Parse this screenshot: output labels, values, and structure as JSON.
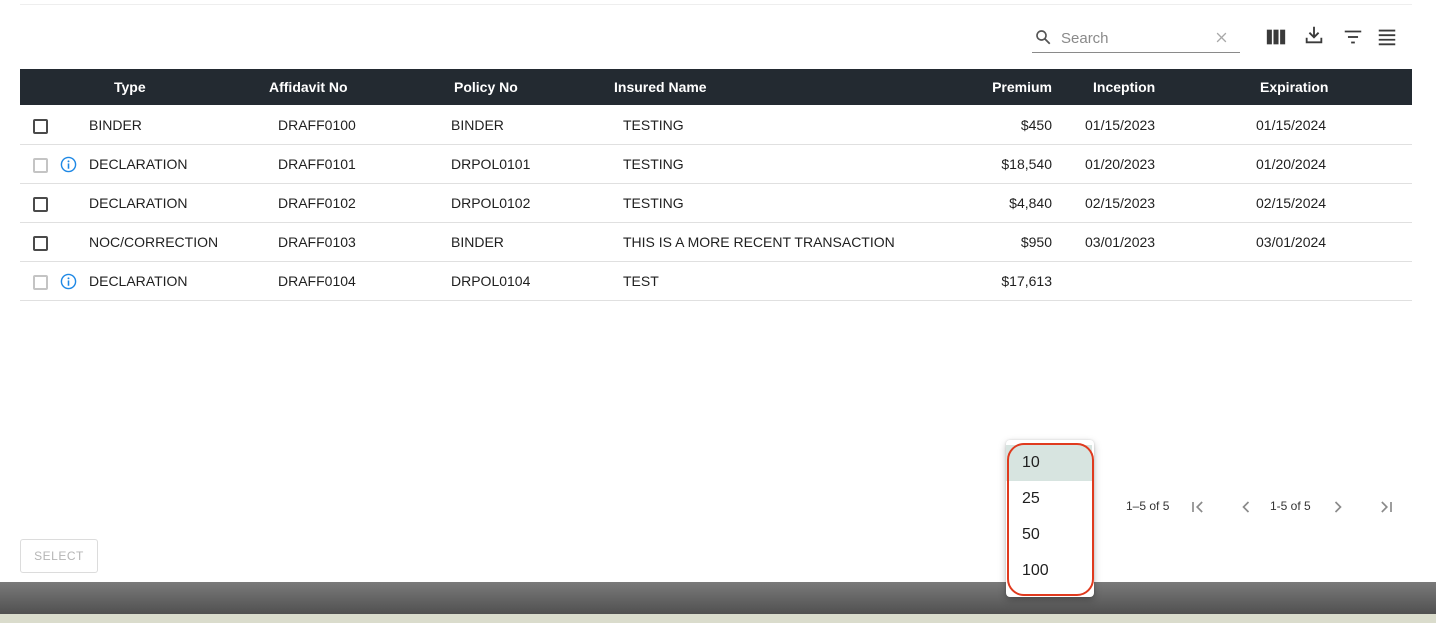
{
  "search": {
    "placeholder": "Search"
  },
  "toolbar": {
    "icons": [
      "columns-icon",
      "download-icon",
      "filter-icon",
      "density-icon"
    ]
  },
  "table": {
    "columns": [
      "Type",
      "Affidavit No",
      "Policy No",
      "Insured Name",
      "Premium",
      "Inception",
      "Expiration"
    ],
    "rows": [
      {
        "type": "BINDER",
        "affidavit": "DRAFF0100",
        "policy": "BINDER",
        "insured": "TESTING",
        "premium": "$450",
        "inception": "01/15/2023",
        "expiration": "01/15/2024",
        "selectable": true,
        "info": false
      },
      {
        "type": "DECLARATION",
        "affidavit": "DRAFF0101",
        "policy": "DRPOL0101",
        "insured": "TESTING",
        "premium": "$18,540",
        "inception": "01/20/2023",
        "expiration": "01/20/2024",
        "selectable": false,
        "info": true
      },
      {
        "type": "DECLARATION",
        "affidavit": "DRAFF0102",
        "policy": "DRPOL0102",
        "insured": "TESTING",
        "premium": "$4,840",
        "inception": "02/15/2023",
        "expiration": "02/15/2024",
        "selectable": true,
        "info": false
      },
      {
        "type": "NOC/CORRECTION",
        "affidavit": "DRAFF0103",
        "policy": "BINDER",
        "insured": "THIS IS A MORE RECENT TRANSACTION",
        "premium": "$950",
        "inception": "03/01/2023",
        "expiration": "03/01/2024",
        "selectable": true,
        "info": false
      },
      {
        "type": "DECLARATION",
        "affidavit": "DRAFF0104",
        "policy": "DRPOL0104",
        "insured": "TEST",
        "premium": "$17,613",
        "inception": "",
        "expiration": "",
        "selectable": false,
        "info": true
      }
    ]
  },
  "pagination": {
    "range_label": "1–5 of 5",
    "page_label": "1-5 of 5",
    "rows_per_page_options": [
      "10",
      "25",
      "50",
      "100"
    ],
    "selected_option": "10"
  },
  "actions": {
    "select_label": "SELECT"
  },
  "colors": {
    "header_bg": "#232a31",
    "info_blue": "#1e88e5",
    "highlight": "#e03a1e",
    "selected_option_bg": "#d7e4e0"
  }
}
